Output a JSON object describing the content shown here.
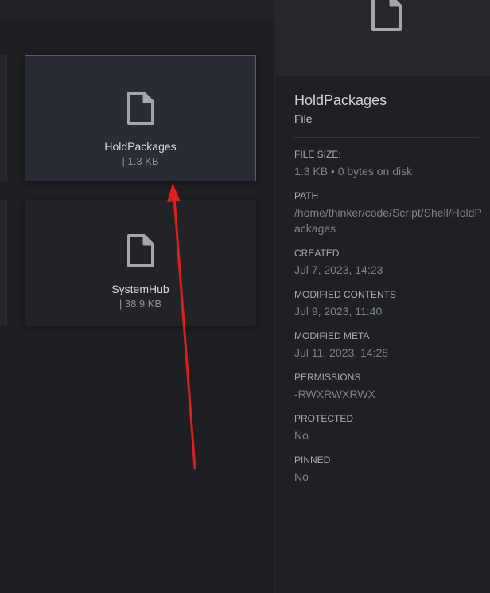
{
  "files": [
    {
      "name": "HoldPackages",
      "meta": "| 1.3 KB",
      "icon": "file-icon"
    },
    {
      "name": "SystemHub",
      "meta": "| 38.9 KB",
      "icon": "file-icon"
    }
  ],
  "inspector": {
    "title": "HoldPackages",
    "kind": "File",
    "properties": [
      {
        "label": "FILE SIZE:",
        "value": "1.3 KB • 0 bytes on disk"
      },
      {
        "label": "PATH",
        "value": "/home/thinker/code/Script/Shell/HoldPackages"
      },
      {
        "label": "CREATED",
        "value": "Jul 7, 2023, 14:23"
      },
      {
        "label": "MODIFIED CONTENTS",
        "value": "Jul 9, 2023, 11:40"
      },
      {
        "label": "MODIFIED META",
        "value": "Jul 11, 2023, 14:28"
      },
      {
        "label": "PERMISSIONS",
        "value": "-RWXRWXRWX"
      },
      {
        "label": "PROTECTED",
        "value": "No"
      },
      {
        "label": "PINNED",
        "value": "No"
      }
    ]
  },
  "colors": {
    "annotation_arrow": "#e01e1e",
    "selection_border": "#5a5c66"
  }
}
